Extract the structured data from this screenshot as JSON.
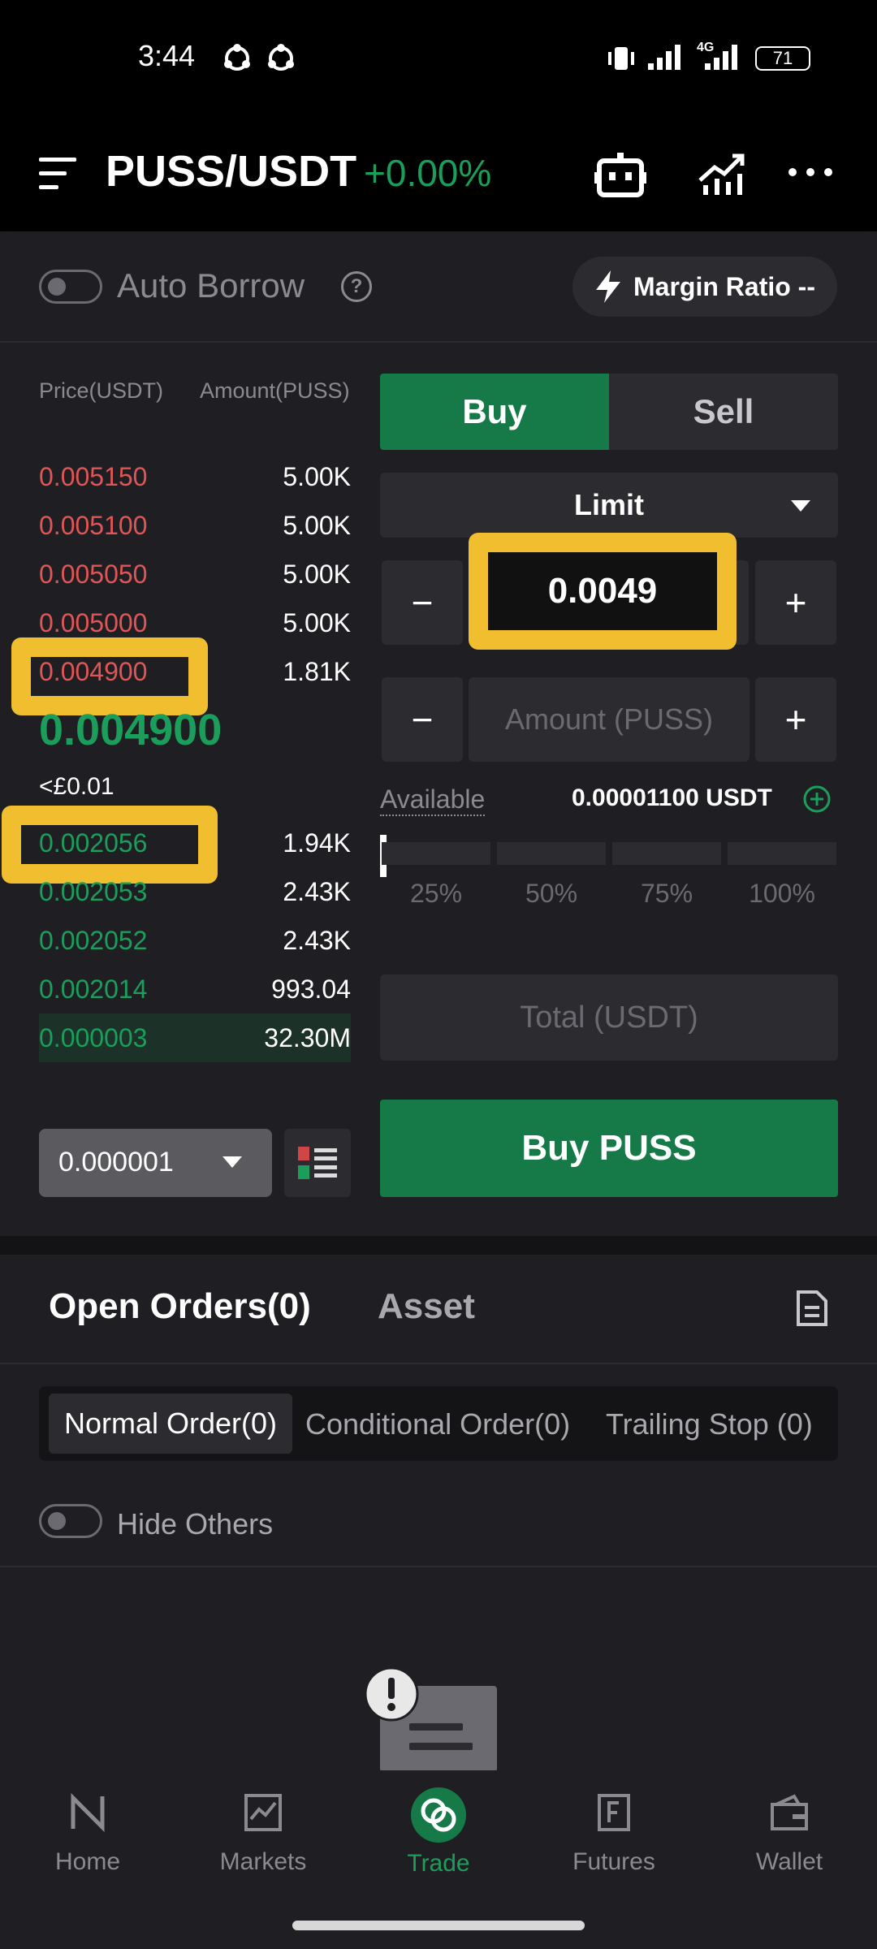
{
  "status_bar": {
    "time": "3:44",
    "network": "4G",
    "battery": "71"
  },
  "header": {
    "pair": "PUSS/USDT",
    "change": "+0.00%"
  },
  "auto_borrow": {
    "label": "Auto Borrow",
    "help": "?"
  },
  "margin_ratio": {
    "label": "Margin Ratio --"
  },
  "order_book": {
    "price_header": "Price(USDT)",
    "amount_header": "Amount(PUSS)",
    "asks": [
      {
        "price": "0.005150",
        "amount": "5.00K"
      },
      {
        "price": "0.005100",
        "amount": "5.00K"
      },
      {
        "price": "0.005050",
        "amount": "5.00K"
      },
      {
        "price": "0.005000",
        "amount": "5.00K"
      },
      {
        "price": "0.004900",
        "amount": "1.81K"
      }
    ],
    "last_price": "0.004900",
    "fiat_price": "<£0.01",
    "bids": [
      {
        "price": "0.002056",
        "amount": "1.94K"
      },
      {
        "price": "0.002053",
        "amount": "2.43K"
      },
      {
        "price": "0.002052",
        "amount": "2.43K"
      },
      {
        "price": "0.002014",
        "amount": "993.04"
      },
      {
        "price": "0.000003",
        "amount": "32.30M"
      }
    ],
    "precision": "0.000001"
  },
  "trade_form": {
    "buy_tab": "Buy",
    "sell_tab": "Sell",
    "order_type": "Limit",
    "price_value": "0.0049",
    "amount_placeholder": "Amount (PUSS)",
    "minus": "−",
    "plus": "+",
    "available_label": "Available",
    "available_value": "0.00001100 USDT",
    "percentages": [
      "25%",
      "50%",
      "75%",
      "100%"
    ],
    "slider_fraction": 0,
    "total_placeholder": "Total (USDT)",
    "submit_label": "Buy PUSS"
  },
  "orders": {
    "tabs": [
      "Open Orders(0)",
      "Asset"
    ],
    "subtabs": [
      "Normal Order(0)",
      "Conditional Order(0)",
      "Trailing Stop (0)"
    ],
    "hide_others": "Hide Others"
  },
  "nav": {
    "items": [
      {
        "label": "Home",
        "icon": "home-icon"
      },
      {
        "label": "Markets",
        "icon": "markets-icon"
      },
      {
        "label": "Trade",
        "icon": "trade-icon"
      },
      {
        "label": "Futures",
        "icon": "futures-icon"
      },
      {
        "label": "Wallet",
        "icon": "wallet-icon"
      }
    ],
    "active": "Trade"
  },
  "colors": {
    "green": "#1b9e5b",
    "red": "#e05555",
    "highlight": "#f0be2e",
    "buy_button": "#157a47"
  }
}
